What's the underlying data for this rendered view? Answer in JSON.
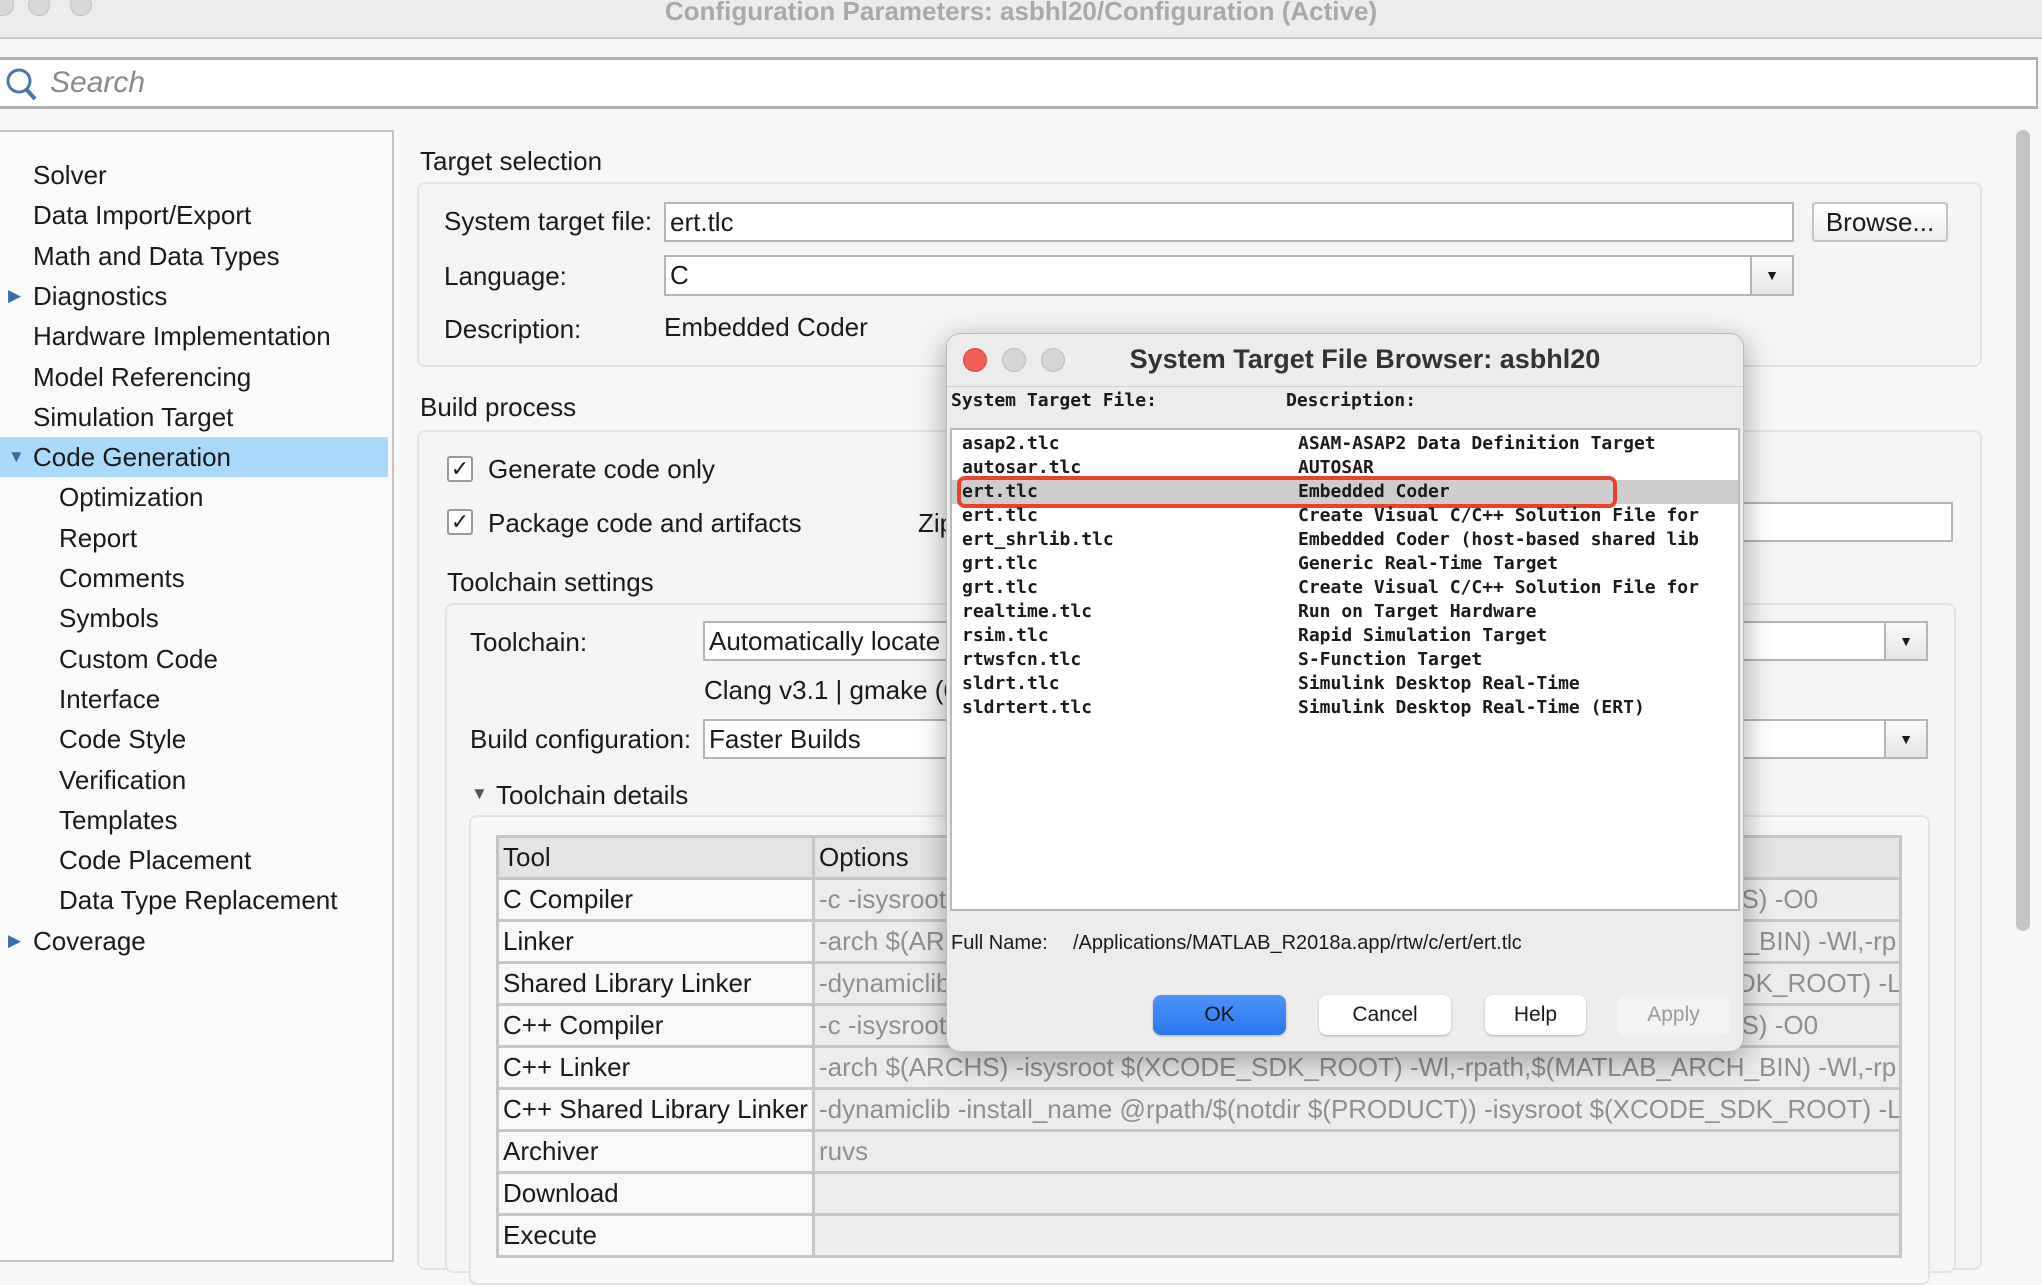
{
  "window": {
    "title": "Configuration Parameters: asbhl20/Configuration (Active)"
  },
  "search": {
    "placeholder": "Search"
  },
  "sidebar": {
    "items": [
      {
        "label": "Solver",
        "level": 0
      },
      {
        "label": "Data Import/Export",
        "level": 0
      },
      {
        "label": "Math and Data Types",
        "level": 0
      },
      {
        "label": "Diagnostics",
        "level": 0,
        "expander": "collapsed"
      },
      {
        "label": "Hardware Implementation",
        "level": 0
      },
      {
        "label": "Model Referencing",
        "level": 0
      },
      {
        "label": "Simulation Target",
        "level": 0
      },
      {
        "label": "Code Generation",
        "level": 0,
        "expander": "expanded",
        "selected": true
      },
      {
        "label": "Optimization",
        "level": 1
      },
      {
        "label": "Report",
        "level": 1
      },
      {
        "label": "Comments",
        "level": 1
      },
      {
        "label": "Symbols",
        "level": 1
      },
      {
        "label": "Custom Code",
        "level": 1
      },
      {
        "label": "Interface",
        "level": 1
      },
      {
        "label": "Code Style",
        "level": 1
      },
      {
        "label": "Verification",
        "level": 1
      },
      {
        "label": "Templates",
        "level": 1
      },
      {
        "label": "Code Placement",
        "level": 1
      },
      {
        "label": "Data Type Replacement",
        "level": 1
      },
      {
        "label": "Coverage",
        "level": 0,
        "expander": "collapsed"
      }
    ]
  },
  "target": {
    "heading": "Target selection",
    "stf_label": "System target file:",
    "stf_value": "ert.tlc",
    "browse": "Browse...",
    "lang_label": "Language:",
    "lang_value": "C",
    "desc_label": "Description:",
    "desc_value": "Embedded Coder"
  },
  "build": {
    "heading": "Build process",
    "gen_only": {
      "label": "Generate code only",
      "checked": true
    },
    "package": {
      "label": "Package code and artifacts",
      "checked": true
    },
    "zip_label": "Zip file name:",
    "toolchain_heading": "Toolchain settings",
    "toolchain_label": "Toolchain:",
    "toolchain_value": "Automatically locate an installed toolchain",
    "toolchain_info": "Clang v3.1 | gmake (64-bit Mac)",
    "buildcfg_label": "Build configuration:",
    "buildcfg_value": "Faster Builds",
    "details_heading": "Toolchain details",
    "table": {
      "headers": [
        "Tool",
        "Options"
      ],
      "rows": [
        [
          "C Compiler",
          "-c -isysroot $(XCODE_SDK_ROOT) -mmacosx-version-min=10.9 -arch $(ARCHS) -O0"
        ],
        [
          "Linker",
          "-arch $(ARCHS) -isysroot $(XCODE_SDK_ROOT) -Wl,-rpath,$(MATLAB_ARCH_BIN) -Wl,-rp"
        ],
        [
          "Shared Library Linker",
          "-dynamiclib -install_name @rpath/$(notdir $(PRODUCT)) -isysroot $(XCODE_SDK_ROOT) -L"
        ],
        [
          "C++ Compiler",
          "-c -isysroot $(XCODE_SDK_ROOT) -mmacosx-version-min=10.9 -arch $(ARCHS) -O0"
        ],
        [
          "C++ Linker",
          "-arch $(ARCHS) -isysroot $(XCODE_SDK_ROOT) -Wl,-rpath,$(MATLAB_ARCH_BIN) -Wl,-rp"
        ],
        [
          "C++ Shared Library Linker",
          "-dynamiclib -install_name @rpath/$(notdir $(PRODUCT)) -isysroot $(XCODE_SDK_ROOT) -L"
        ],
        [
          "Archiver",
          "ruvs"
        ],
        [
          "Download",
          ""
        ],
        [
          "Execute",
          ""
        ]
      ]
    }
  },
  "dialog": {
    "title": "System Target File Browser: asbhl20",
    "col_file": "System Target File:",
    "col_desc": "Description:",
    "rows": [
      {
        "file": "asap2.tlc",
        "desc": "ASAM-ASAP2 Data Definition Target"
      },
      {
        "file": "autosar.tlc",
        "desc": "AUTOSAR"
      },
      {
        "file": "ert.tlc",
        "desc": "Embedded Coder",
        "selected": true
      },
      {
        "file": "ert.tlc",
        "desc": "Create Visual C/C++ Solution File for"
      },
      {
        "file": "ert_shrlib.tlc",
        "desc": "Embedded Coder (host-based shared lib"
      },
      {
        "file": "grt.tlc",
        "desc": "Generic Real-Time Target"
      },
      {
        "file": "grt.tlc",
        "desc": "Create Visual C/C++ Solution File for"
      },
      {
        "file": "realtime.tlc",
        "desc": "Run on Target Hardware"
      },
      {
        "file": "rsim.tlc",
        "desc": "Rapid Simulation Target"
      },
      {
        "file": "rtwsfcn.tlc",
        "desc": "S-Function Target"
      },
      {
        "file": "sldrt.tlc",
        "desc": "Simulink Desktop Real-Time"
      },
      {
        "file": "sldrtert.tlc",
        "desc": "Simulink Desktop Real-Time (ERT)"
      }
    ],
    "fullname_label": "Full Name:",
    "fullname_value": "/Applications/MATLAB_R2018a.app/rtw/c/ert/ert.tlc",
    "ok": "OK",
    "cancel": "Cancel",
    "help": "Help",
    "apply": "Apply",
    "highlight_color": "#e8412c",
    "ok_color": "#3a86f7"
  }
}
